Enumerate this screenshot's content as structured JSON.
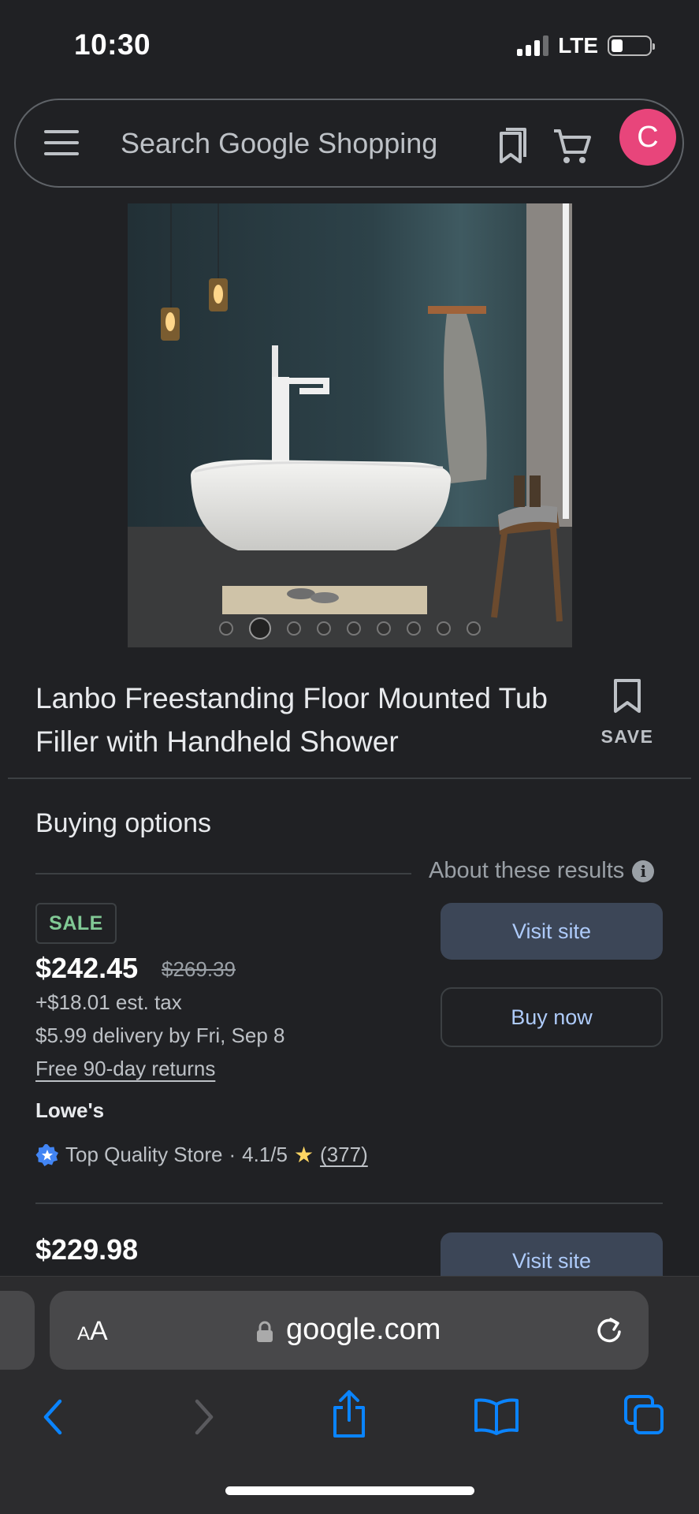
{
  "status_bar": {
    "time": "10:30",
    "network": "LTE",
    "battery_percent": 20
  },
  "search": {
    "placeholder": "Search Google Shopping",
    "avatar_letter": "C"
  },
  "carousel": {
    "total_images": 9,
    "active_index": 1
  },
  "product": {
    "title": "Lanbo Freestanding Floor Mounted Tub Filler with Handheld Shower",
    "save_label": "SAVE"
  },
  "buying_options": {
    "title": "Buying options",
    "about": "About these results",
    "offers": [
      {
        "badge": "SALE",
        "price": "$242.45",
        "old_price": "$269.39",
        "tax": "+$18.01 est. tax",
        "delivery": "$5.99 delivery by Fri, Sep 8",
        "returns": "Free 90-day returns",
        "store": "Lowe's",
        "store_badge": "Top Quality Store",
        "separator": "·",
        "rating": "4.1/5",
        "reviews": "(377)",
        "visit_label": "Visit site",
        "buy_label": "Buy now"
      },
      {
        "price": "$229.98",
        "visit_label": "Visit site"
      }
    ]
  },
  "browser": {
    "text_size_small": "A",
    "text_size_big": "A",
    "url": "google.com"
  },
  "colors": {
    "background": "#202124",
    "accent_link": "#aecbfa",
    "sale_green": "#81c995",
    "avatar": "#e8457b",
    "ios_blue": "#0a84ff",
    "star": "#fdd663"
  },
  "icons": [
    "menu-icon",
    "bookmark-icon",
    "cart-icon",
    "save-bookmark-icon",
    "info-icon",
    "top-quality-badge-icon",
    "star-icon",
    "lock-icon",
    "reload-icon",
    "back-icon",
    "forward-icon",
    "share-icon",
    "bookmarks-icon",
    "tabs-icon"
  ]
}
